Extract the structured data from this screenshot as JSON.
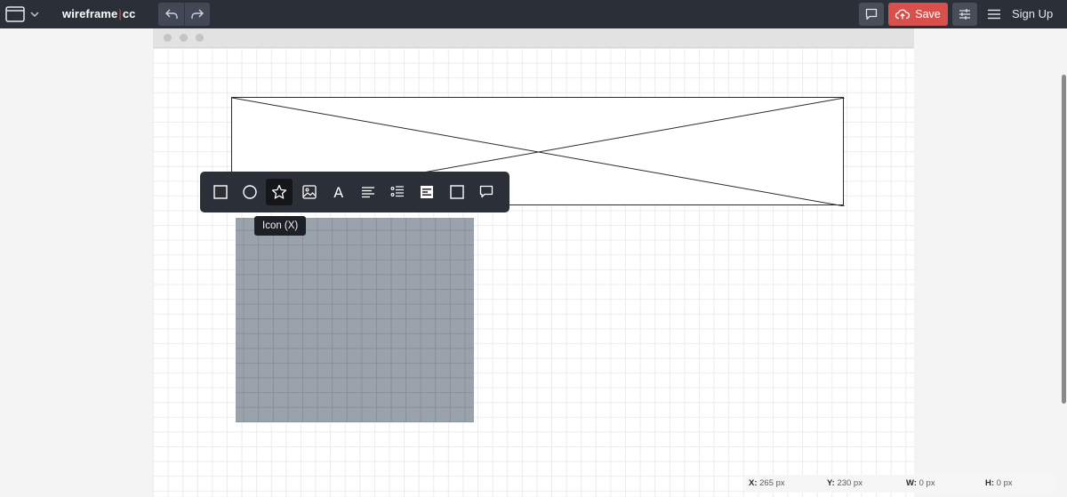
{
  "app": {
    "logo_text": "wireframe",
    "logo_sep": "|",
    "logo_suffix": "cc"
  },
  "header": {
    "save_label": "Save",
    "signup_label": "Sign Up"
  },
  "toolbar": {
    "tools": [
      {
        "name": "rectangle",
        "icon": "square-icon"
      },
      {
        "name": "circle",
        "icon": "circle-icon"
      },
      {
        "name": "icon",
        "icon": "star-icon",
        "active": true
      },
      {
        "name": "image",
        "icon": "image-icon"
      },
      {
        "name": "text",
        "icon": "text-icon",
        "glyph": "A"
      },
      {
        "name": "paragraph",
        "icon": "align-left-icon"
      },
      {
        "name": "list",
        "icon": "list-icon"
      },
      {
        "name": "browser-block",
        "icon": "browser-icon"
      },
      {
        "name": "box",
        "icon": "square-icon"
      },
      {
        "name": "comment",
        "icon": "speech-bubble-icon"
      }
    ],
    "tooltip": "Icon (X)"
  },
  "status": {
    "x_label": "X:",
    "x_value": "265 px",
    "y_label": "Y:",
    "y_value": "230 px",
    "w_label": "W:",
    "w_value": "0 px",
    "h_label": "H:",
    "h_value": "0 px"
  },
  "colors": {
    "topbar": "#2b2f37",
    "save": "#d8504b",
    "selection": "#9aa2ac"
  }
}
